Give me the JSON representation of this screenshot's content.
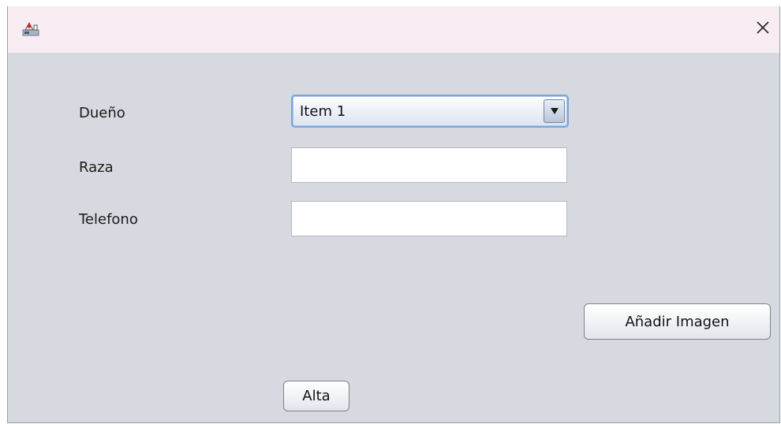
{
  "window": {
    "app_icon": "java-duke-icon",
    "close_icon": "close-icon"
  },
  "form": {
    "owner_label": "Dueño",
    "owner_select_value": "Item 1",
    "owner_select_arrow_icon": "chevron-down-icon",
    "breed_label": "Raza",
    "breed_value": "",
    "phone_label": "Telefono",
    "phone_value": ""
  },
  "buttons": {
    "add_image_label": "Añadir Imagen",
    "submit_label": "Alta"
  },
  "colors": {
    "titlebar_bg": "#f7ecf2",
    "window_bg": "#d6d9df",
    "combo_focus_border": "#7aa6d8"
  }
}
